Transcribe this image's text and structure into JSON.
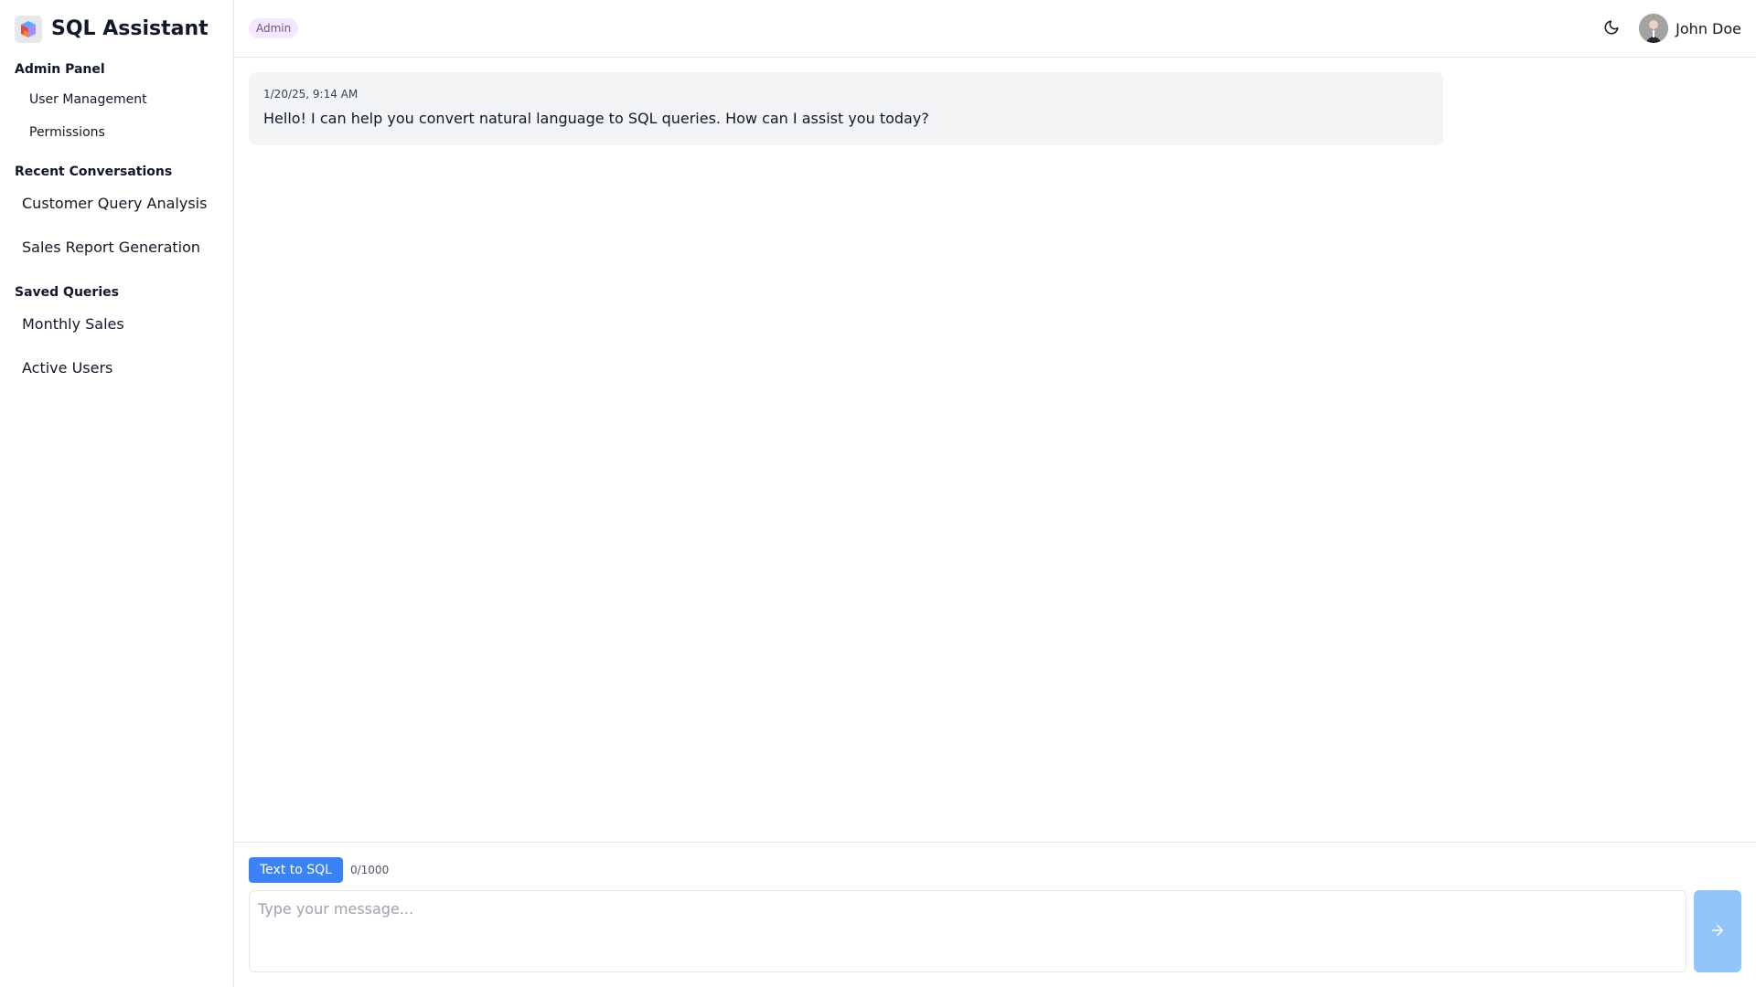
{
  "app": {
    "title": "SQL Assistant"
  },
  "sidebar": {
    "admin_panel": {
      "title": "Admin Panel",
      "items": [
        {
          "label": "User Management"
        },
        {
          "label": "Permissions"
        }
      ]
    },
    "recent_conversations": {
      "title": "Recent Conversations",
      "items": [
        {
          "label": "Customer Query Analysis"
        },
        {
          "label": "Sales Report Generation"
        }
      ]
    },
    "saved_queries": {
      "title": "Saved Queries",
      "items": [
        {
          "label": "Monthly Sales"
        },
        {
          "label": "Active Users"
        }
      ]
    }
  },
  "header": {
    "role_badge": "Admin",
    "theme_icon": "moon-icon",
    "user": {
      "name": "John Doe"
    }
  },
  "messages": [
    {
      "timestamp": "1/20/25, 9:14 AM",
      "text": "Hello! I can help you convert natural language to SQL queries. How can I assist you today?"
    }
  ],
  "composer": {
    "mode_label": "Text to SQL",
    "char_count": "0/1000",
    "placeholder": "Type your message...",
    "value": "",
    "send_icon": "arrow-right-icon"
  },
  "colors": {
    "accent": "#3b82f6",
    "send_disabled": "#93c5fd",
    "badge_bg": "#f3e8ff",
    "message_bg": "#f3f4f6",
    "border": "#e5e7eb"
  }
}
